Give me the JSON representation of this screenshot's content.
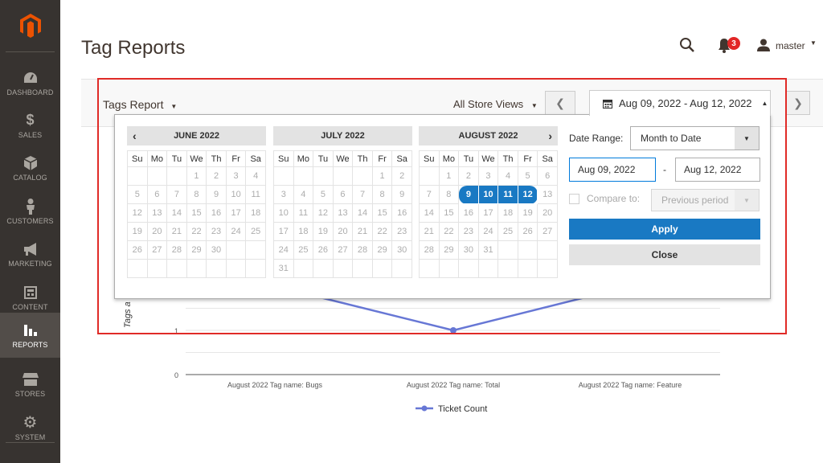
{
  "sidebar": {
    "items": [
      {
        "label": "DASHBOARD",
        "icon": "dashboard-icon"
      },
      {
        "label": "SALES",
        "icon": "dollar-icon"
      },
      {
        "label": "CATALOG",
        "icon": "box-icon"
      },
      {
        "label": "CUSTOMERS",
        "icon": "person-icon"
      },
      {
        "label": "MARKETING",
        "icon": "megaphone-icon"
      },
      {
        "label": "CONTENT",
        "icon": "content-icon"
      },
      {
        "label": "REPORTS",
        "icon": "bar-chart-icon"
      },
      {
        "label": "STORES",
        "icon": "store-icon"
      },
      {
        "label": "SYSTEM",
        "icon": "gear-icon"
      }
    ]
  },
  "header": {
    "title": "Tag Reports",
    "notifications_count": "3",
    "username": "master"
  },
  "toolbar": {
    "report_select": "Tags Report",
    "store_select": "All Store Views",
    "date_range_button": "Aug 09, 2022 - Aug 12, 2022"
  },
  "picker": {
    "weekdays": [
      "Su",
      "Mo",
      "Tu",
      "We",
      "Th",
      "Fr",
      "Sa"
    ],
    "months": [
      {
        "name": "JUNE 2022",
        "start": 3,
        "days": 30,
        "selected": []
      },
      {
        "name": "JULY 2022",
        "start": 5,
        "days": 31,
        "selected": []
      },
      {
        "name": "AUGUST 2022",
        "start": 1,
        "days": 31,
        "selected": [
          9,
          10,
          11,
          12
        ]
      }
    ],
    "date_range_label": "Date Range:",
    "date_range_value": "Month to Date",
    "from_date": "Aug 09, 2022",
    "to_date": "Aug 12, 2022",
    "dash": "-",
    "compare_label": "Compare to:",
    "compare_value": "Previous period",
    "apply_label": "Apply",
    "close_label": "Close"
  },
  "chart_data": {
    "type": "line",
    "categories": [
      "August 2022 Tag name: Bugs",
      "August 2022 Tag name: Total",
      "August 2022 Tag name: Feature"
    ],
    "series": [
      {
        "name": "Ticket Count",
        "values": [
          2,
          1,
          2
        ]
      }
    ],
    "y_ticks": [
      "0",
      "1"
    ],
    "ylabel": "Tags a",
    "ylim": [
      0,
      2.4
    ],
    "grid": true,
    "legend_position": "bottom",
    "line_color": "#6777d5"
  }
}
